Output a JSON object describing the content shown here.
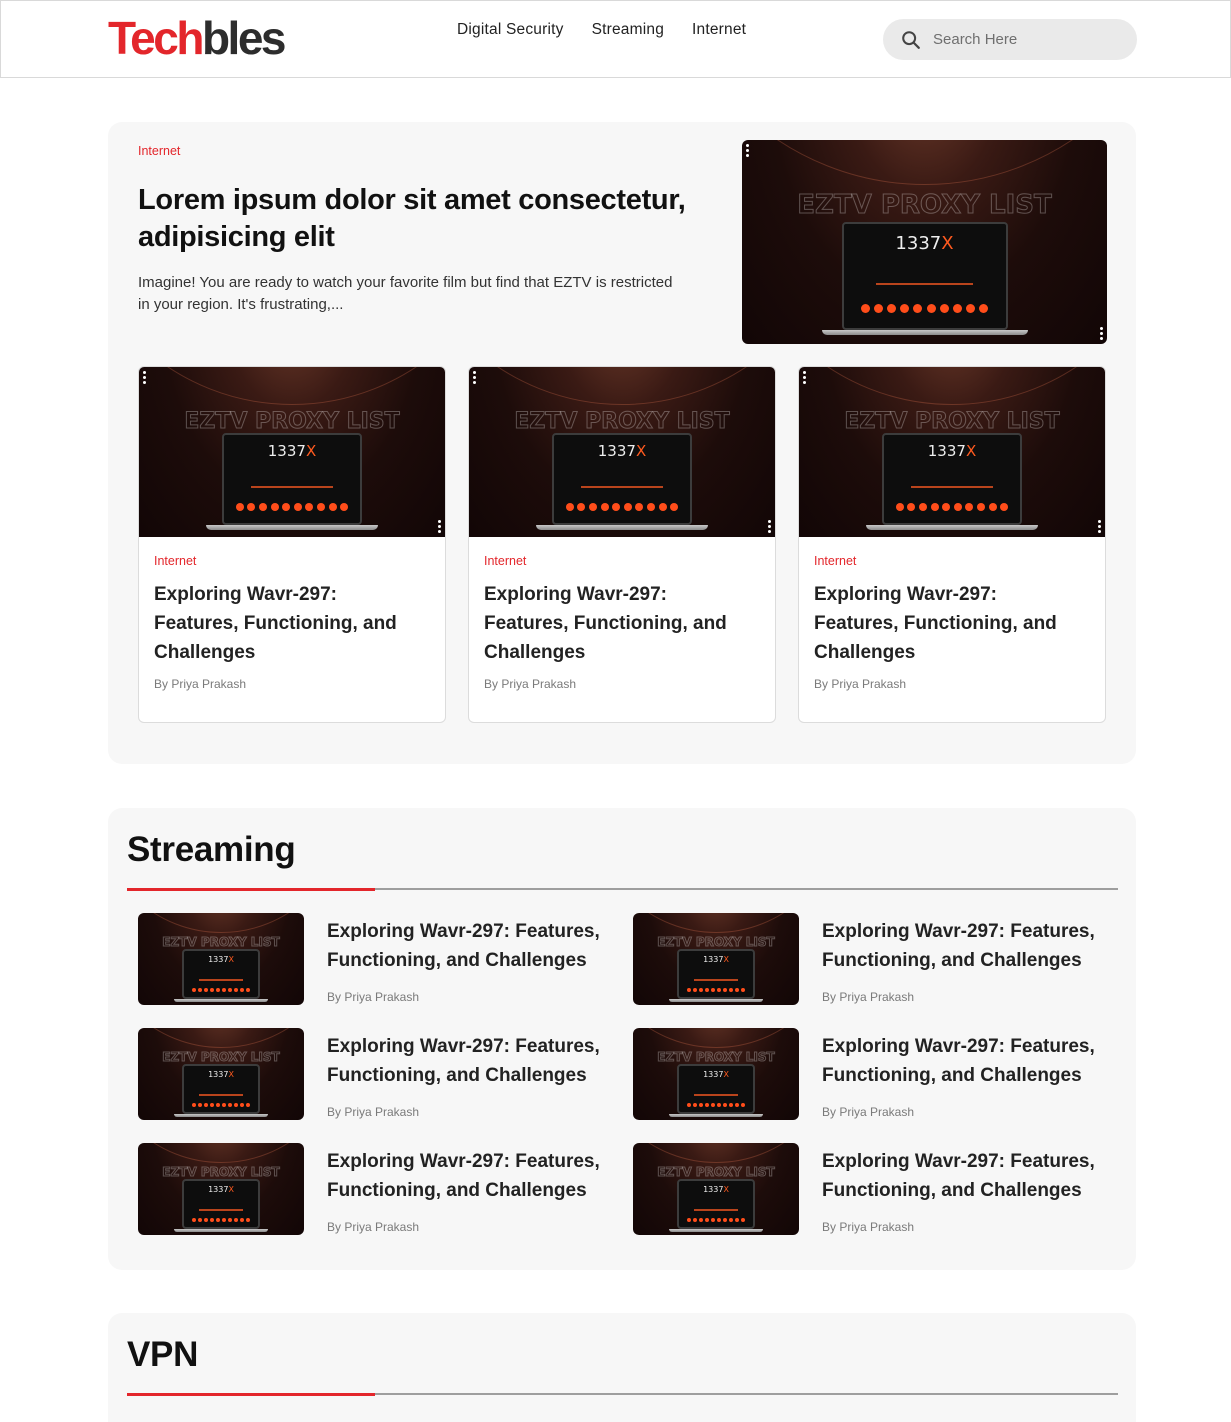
{
  "header": {
    "logo_part1": "Tech",
    "logo_part2": "bles",
    "nav": [
      "Digital Security",
      "Streaming",
      "Internet"
    ],
    "search_placeholder": "Search Here"
  },
  "featured": {
    "category": "Internet",
    "title": "Lorem ipsum dolor sit amet consectetur, adipisicing elit",
    "excerpt": "Imagine! You are ready to watch your favorite film but find that EZTV is restricted in your region. It's frustrating,...",
    "image_watermark": "EZTV PROXY LIST",
    "image_brand_a": "1337",
    "image_brand_b": "X"
  },
  "cards": [
    {
      "category": "Internet",
      "title": "Exploring Wavr-297: Features, Functioning, and Challenges",
      "author": "By Priya Prakash"
    },
    {
      "category": "Internet",
      "title": "Exploring Wavr-297: Features, Functioning, and Challenges",
      "author": "By Priya Prakash"
    },
    {
      "category": "Internet",
      "title": "Exploring Wavr-297: Features, Functioning, and Challenges",
      "author": "By Priya Prakash"
    }
  ],
  "streaming": {
    "heading": "Streaming",
    "items": [
      {
        "title": "Exploring Wavr-297: Features, Functioning, and Challenges",
        "author": "By Priya Prakash"
      },
      {
        "title": "Exploring Wavr-297: Features, Functioning, and Challenges",
        "author": "By Priya Prakash"
      },
      {
        "title": "Exploring Wavr-297: Features, Functioning, and Challenges",
        "author": "By Priya Prakash"
      },
      {
        "title": "Exploring Wavr-297: Features, Functioning, and Challenges",
        "author": "By Priya Prakash"
      },
      {
        "title": "Exploring Wavr-297: Features, Functioning, and Challenges",
        "author": "By Priya Prakash"
      },
      {
        "title": "Exploring Wavr-297: Features, Functioning, and Challenges",
        "author": "By Priya Prakash"
      }
    ]
  },
  "vpn": {
    "heading": "VPN"
  },
  "colors": {
    "accent": "#e3262b",
    "panel": "#f7f7f7",
    "text": "#111111"
  },
  "icons": {
    "search": "search-icon",
    "menu": "kebab-menu-icon"
  }
}
